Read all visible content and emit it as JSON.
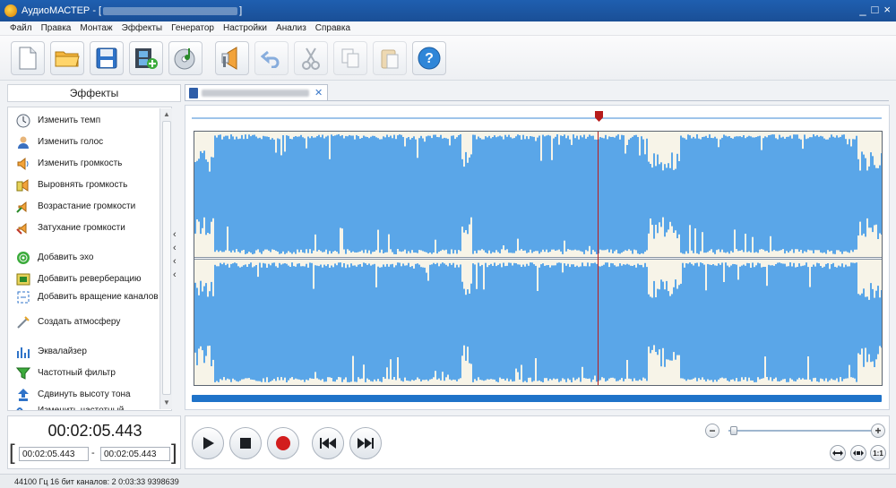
{
  "window": {
    "title": "АудиоМАСТЕР - [",
    "title_suffix": "]",
    "controls": [
      "_",
      "□",
      "×"
    ]
  },
  "menu": [
    "Файл",
    "Правка",
    "Монтаж",
    "Эффекты",
    "Генератор",
    "Настройки",
    "Анализ",
    "Справка"
  ],
  "toolbar": {
    "icons": [
      "new-file-icon",
      "open-folder-icon",
      "save-disk-icon",
      "add-video-icon",
      "cd-music-icon",
      "record-voice-icon",
      "undo-icon",
      "cut-icon",
      "copy-icon",
      "paste-icon",
      "help-icon"
    ]
  },
  "effects_panel": {
    "title": "Эффекты",
    "items": [
      {
        "label": "Изменить темп",
        "icon": "clock-icon"
      },
      {
        "label": "Изменить голос",
        "icon": "person-icon"
      },
      {
        "label": "Изменить громкость",
        "icon": "volume-icon"
      },
      {
        "label": "Выровнять громкость",
        "icon": "level-volume-icon"
      },
      {
        "label": "Возрастание громкости",
        "icon": "fade-in-icon"
      },
      {
        "label": "Затухание громкости",
        "icon": "fade-out-icon"
      },
      {
        "label": "Добавить эхо",
        "icon": "echo-icon"
      },
      {
        "label": "Добавить реверберацию",
        "icon": "reverb-icon"
      },
      {
        "label": "Добавить вращение каналов",
        "icon": "rotate-channels-icon"
      },
      {
        "label": "Создать атмосферу",
        "icon": "atmosphere-icon"
      },
      {
        "label": "Эквалайзер",
        "icon": "equalizer-icon"
      },
      {
        "label": "Частотный фильтр",
        "icon": "filter-icon"
      },
      {
        "label": "Сдвинуть высоту тона",
        "icon": "pitch-shift-icon"
      },
      {
        "label": "Изменить частотный",
        "icon": "frequency-icon"
      }
    ]
  },
  "time": {
    "current": "00:02:05.443",
    "selection_start": "00:02:05.443",
    "selection_end": "00:02:05.443",
    "separator": "-"
  },
  "zoom": {
    "minus": "−",
    "plus": "+",
    "fit_label": "1:1",
    "level": 0.02
  },
  "playhead_fraction": 0.587,
  "status": "44100 Гц  16 бит  каналов: 2   0:03:33 9398639",
  "colors": {
    "title_bar": "#1f5fb0",
    "waveform_bg": "#5aa6e8",
    "waveform": "#f7f4e8",
    "playhead": "#b71c1c",
    "scroll": "#1f73c9"
  }
}
